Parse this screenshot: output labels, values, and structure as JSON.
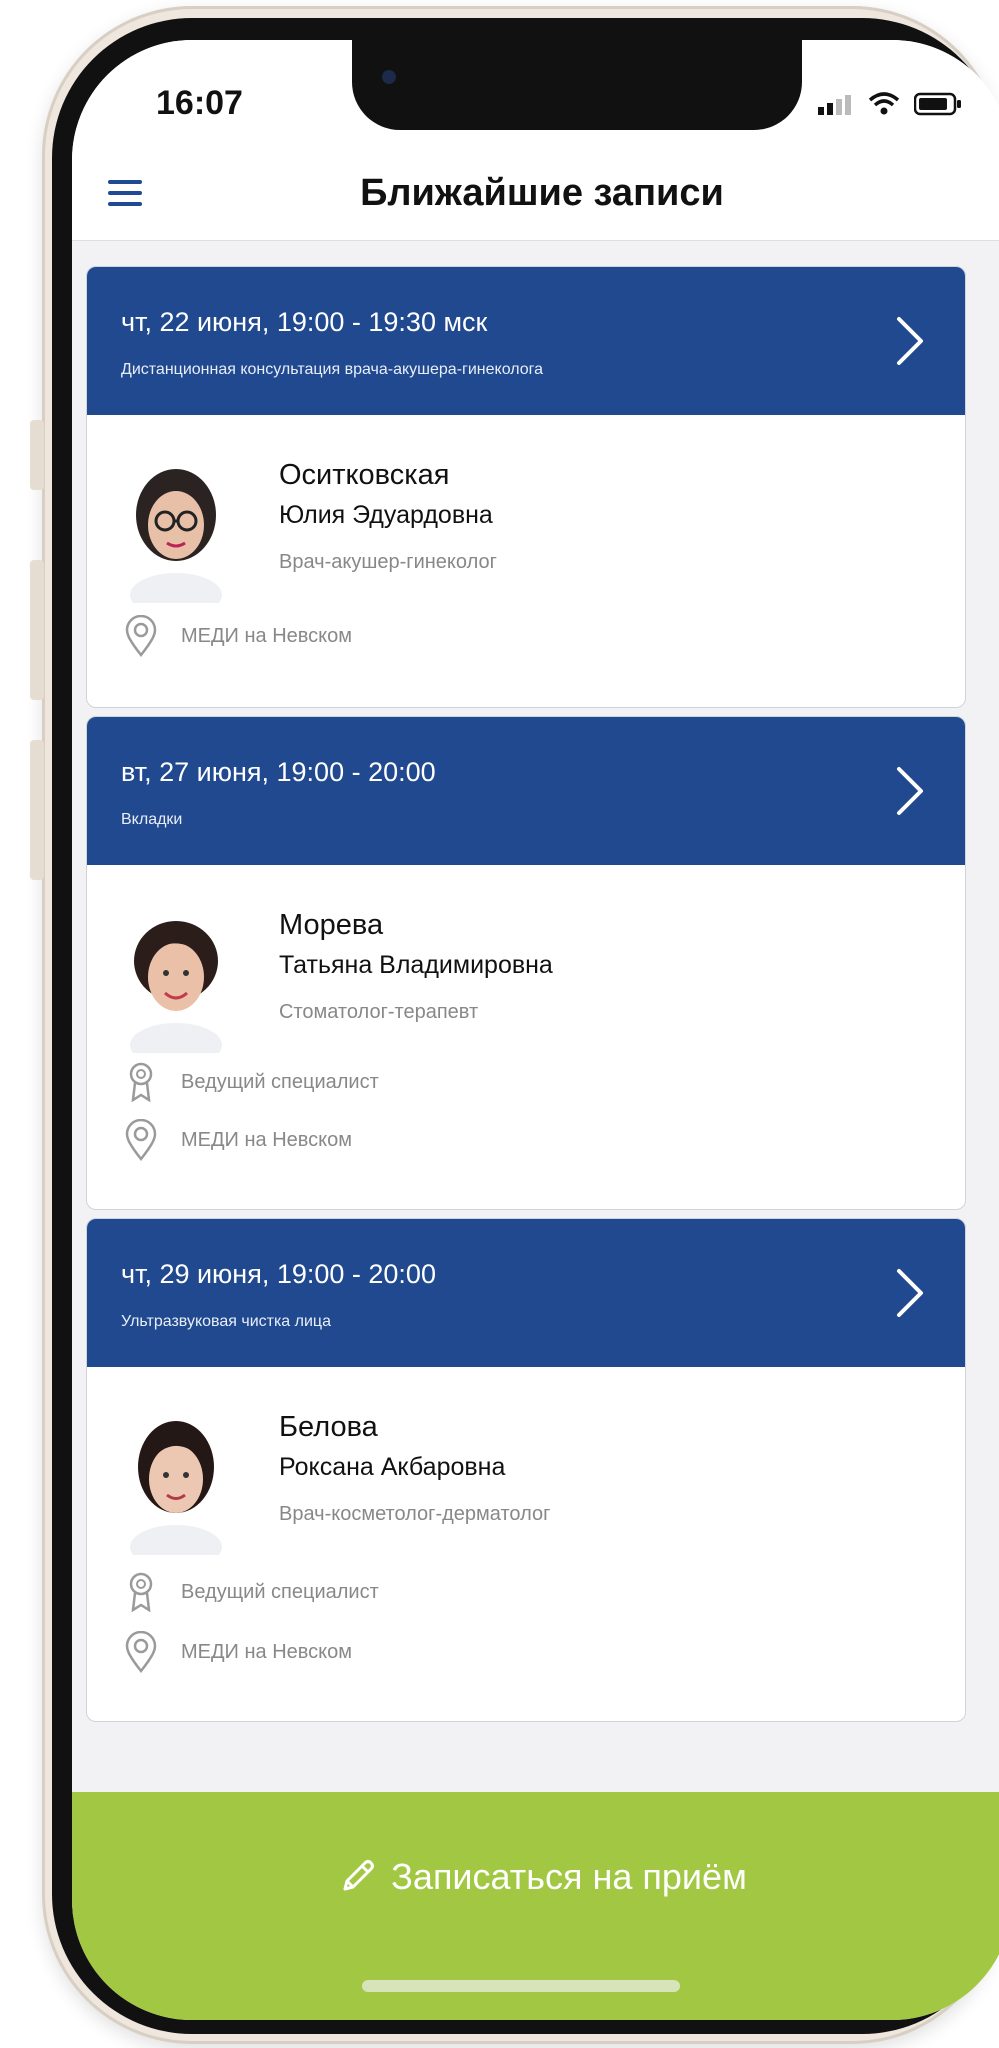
{
  "status_bar": {
    "time": "16:07"
  },
  "nav": {
    "title": "Ближайшие записи"
  },
  "appointments": [
    {
      "datetime": "чт, 22 июня, 19:00 - 19:30 мск",
      "service": "Дистанционная консультация врача-акушера-гинеколога",
      "last_name": "Оситковская",
      "first_names": "Юлия Эдуардовна",
      "specialty": "Врач-акушер-гинеколог",
      "location": "МЕДИ на Невском"
    },
    {
      "datetime": "вт, 27 июня, 19:00 - 20:00",
      "service": "Вкладки",
      "last_name": "Морева",
      "first_names": "Татьяна Владимировна",
      "specialty": "Стоматолог-терапевт",
      "rank": "Ведущий специалист",
      "location": "МЕДИ на Невском"
    },
    {
      "datetime": "чт, 29 июня, 19:00 - 20:00",
      "service": "Ультразвуковая чистка лица",
      "last_name": "Белова",
      "first_names": "Роксана Акбаровна",
      "specialty": "Врач-косметолог-дерматолог",
      "rank": "Ведущий специалист",
      "location": "МЕДИ на Невском"
    }
  ],
  "cta": {
    "label": "Записаться на приём"
  },
  "colors": {
    "header_blue": "#21498f",
    "cta_green": "#a2c743",
    "menu_icon": "#1f4a94"
  }
}
